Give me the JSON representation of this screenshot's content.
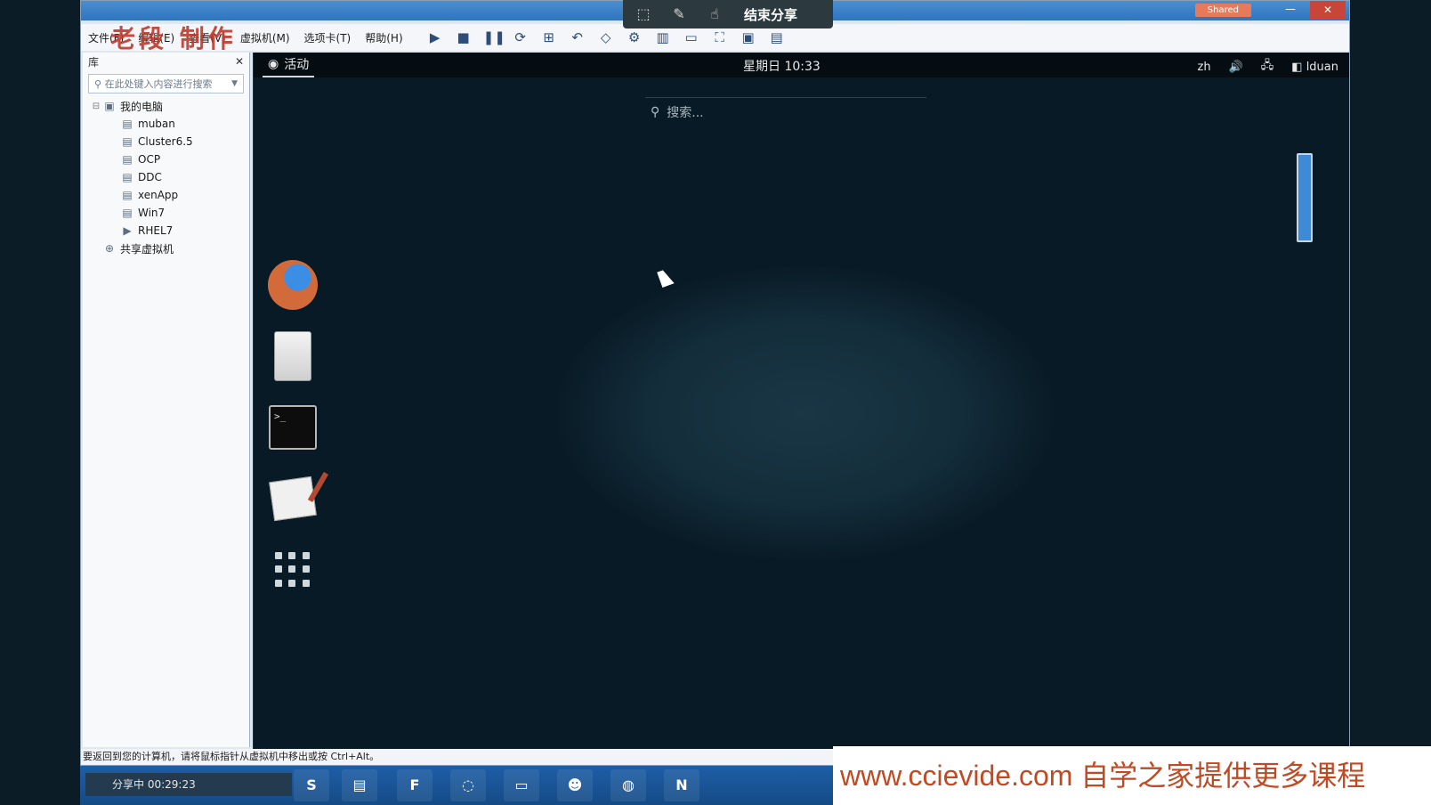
{
  "titlebar": {
    "shared_label": "Shared"
  },
  "sharebar": {
    "end_label": "结束分享"
  },
  "watermark": "老段 制作",
  "menu": [
    "文件(F)",
    "编辑(E)",
    "查看(V)",
    "虚拟机(M)",
    "选项卡(T)",
    "帮助(H)"
  ],
  "library": {
    "title": "库",
    "search_placeholder": "在此处键入内容进行搜索",
    "tree": [
      {
        "label": "我的电脑",
        "children": [
          "muban",
          "Cluster6.5",
          "OCP",
          "DDC",
          "xenApp",
          "Win7",
          "RHEL7"
        ]
      },
      {
        "label": "共享虚拟机"
      }
    ]
  },
  "guest": {
    "activities": "活动",
    "clock": "星期日 10:33",
    "lang": "zh",
    "user": "lduan",
    "search_placeholder": "搜索..."
  },
  "statusbar": {
    "message": "要返回到您的计算机，请将鼠标指针从虚拟机中移出或按 Ctrl+Alt。"
  },
  "taskbar": {
    "share_status": "分享中 00:29:23"
  },
  "banner": "www.ccievide.com 自学之家提供更多课程"
}
